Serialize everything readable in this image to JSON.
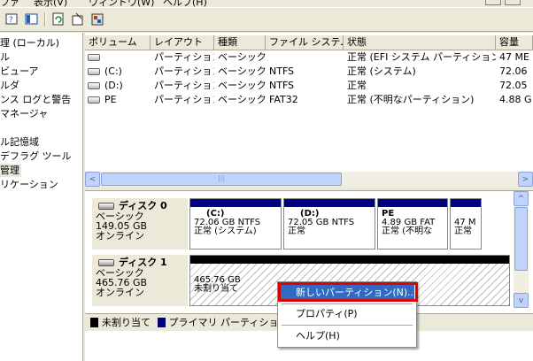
{
  "menubar": {
    "items": [
      "ファ",
      "表示(V)",
      "ウィンドウ(W)",
      "ヘルプ(H)"
    ]
  },
  "toolbar": {
    "icons": [
      "help-icon",
      "console-tree-icon",
      "refresh-icon",
      "properties-icon",
      "settings-icon"
    ]
  },
  "tree": {
    "items": [
      {
        "label": "理 (ローカル)"
      },
      {
        "label": "ル"
      },
      {
        "label": "ビューア"
      },
      {
        "label": "ルダ"
      },
      {
        "label": "ンス ログと警告"
      },
      {
        "label": "マネージャ"
      },
      {
        "label": ""
      },
      {
        "label": "ル記憶域"
      },
      {
        "label": "デフラグ ツール"
      },
      {
        "label": "管理"
      },
      {
        "label": "リケーション"
      }
    ]
  },
  "volume_table": {
    "headers": [
      "ボリューム",
      "レイアウト",
      "種類",
      "ファイル システム",
      "状態",
      "容量"
    ],
    "rows": [
      {
        "volume": "",
        "layout": "パーティション",
        "type": "ベーシック",
        "fs": "",
        "status": "正常 (EFI システム パーティション)",
        "capacity": "47 ME"
      },
      {
        "volume": "(C:)",
        "layout": "パーティション",
        "type": "ベーシック",
        "fs": "NTFS",
        "status": "正常 (システム)",
        "capacity": "72.06"
      },
      {
        "volume": "(D:)",
        "layout": "パーティション",
        "type": "ベーシック",
        "fs": "NTFS",
        "status": "正常",
        "capacity": "72.05"
      },
      {
        "volume": "PE",
        "layout": "パーティション",
        "type": "ベーシック",
        "fs": "FAT32",
        "status": "正常 (不明なパーティション)",
        "capacity": "4.88 G"
      }
    ]
  },
  "scrollbar": {
    "thumb_grip": "|||",
    "left_arrow": "<",
    "right_arrow": ">",
    "up_arrow": "^",
    "down_arrow": "v"
  },
  "disks": [
    {
      "name": "ディスク 0",
      "type": "ベーシック",
      "size": "149.05 GB",
      "status": "オンライン",
      "partitions": [
        {
          "lines": [
            "",
            "",
            ""
          ]
        },
        {
          "lines": [
            "(C:)",
            "72.06 GB NTFS",
            "正常 (システム)"
          ]
        },
        {
          "lines": [
            "(D:)",
            "72.05 GB NTFS",
            "正常"
          ]
        },
        {
          "lines": [
            "PE",
            "4.89 GB FAT",
            "正常 (不明な"
          ]
        },
        {
          "lines": [
            "",
            "47 M",
            "正常"
          ]
        }
      ]
    },
    {
      "name": "ディスク 1",
      "type": "ベーシック",
      "size": "465.76 GB",
      "status": "オンライン",
      "partitions": [
        {
          "lines": [
            "465.76 GB",
            "未割り当て"
          ]
        }
      ]
    }
  ],
  "legend": {
    "unallocated": "未割り当て",
    "primary": "プライマリ パーティション"
  },
  "context_menu": {
    "items": [
      "新しいパーティション(N)...",
      "プロパティ(P)",
      "ヘルプ(H)"
    ]
  },
  "colors": {
    "primary_bar": "#000080",
    "unallocated_bar": "#000000",
    "highlight": "#316ac5",
    "callout": "#e00000"
  }
}
